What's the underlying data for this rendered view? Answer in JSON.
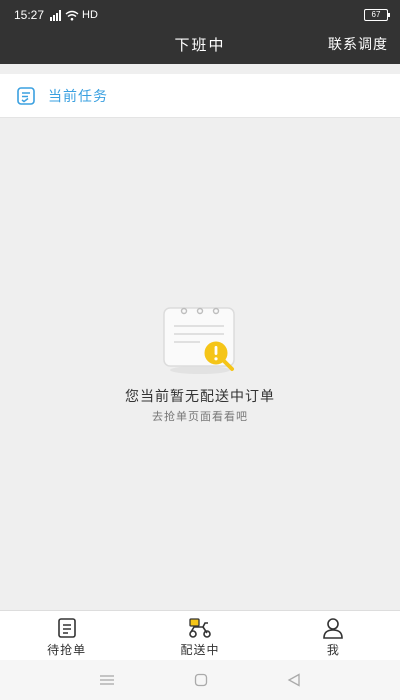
{
  "status_bar": {
    "time": "15:27",
    "network": "HD",
    "battery": "67"
  },
  "header": {
    "title": "下班中",
    "action_label": "联系调度"
  },
  "current_task": {
    "label": "当前任务"
  },
  "empty_state": {
    "message": "您当前暂无配送中订单",
    "hint": "去抢单页面看看吧"
  },
  "tabs": [
    {
      "label": "待抢单",
      "icon": "document-icon"
    },
    {
      "label": "配送中",
      "icon": "scooter-icon",
      "active": true
    },
    {
      "label": "我",
      "icon": "person-icon"
    }
  ],
  "colors": {
    "header_bg": "#333333",
    "accent": "#3aa0e0",
    "badge_yellow": "#f5c518"
  }
}
